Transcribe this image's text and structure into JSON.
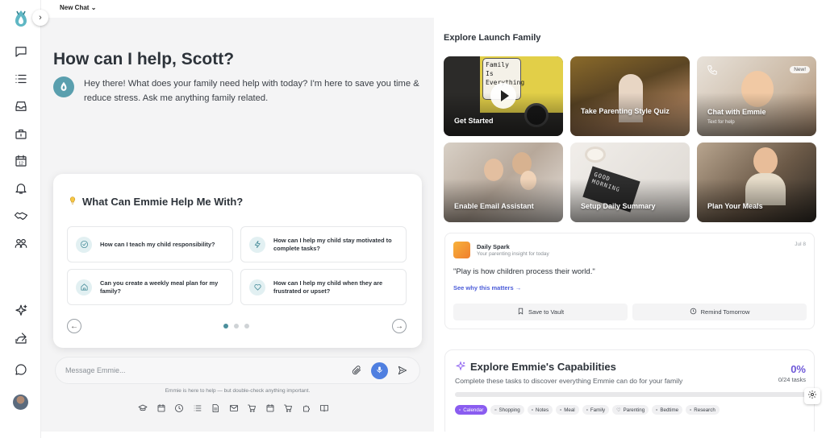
{
  "topbar": {
    "new_chat_label": "New Chat",
    "chevron": "chevron-down-icon"
  },
  "sidebar": {
    "items": [
      {
        "icon": "chat-bubble-icon"
      },
      {
        "icon": "list-icon"
      },
      {
        "icon": "inbox-icon"
      },
      {
        "icon": "briefcase-icon"
      },
      {
        "icon": "calendar-icon",
        "text": "12"
      },
      {
        "icon": "bell-icon"
      },
      {
        "icon": "handshake-icon"
      },
      {
        "icon": "people-icon"
      },
      {
        "icon": "sparkle-icon"
      },
      {
        "icon": "share-icon"
      },
      {
        "icon": "message-circle-icon"
      }
    ]
  },
  "main": {
    "greeting": "How can I help, Scott?",
    "intro": "Hey there! What does your family need help with today? I'm here to save you time & reduce stress. Ask me anything family related.",
    "help_card": {
      "title": "What Can Emmie Help Me With?",
      "questions": [
        {
          "text": "How can I teach my child responsibility?",
          "icon": "check-circle-icon"
        },
        {
          "text": "How can I help my child stay motivated to complete tasks?",
          "icon": "lightning-icon"
        },
        {
          "text": "Can you create a weekly meal plan for my family?",
          "icon": "home-icon"
        },
        {
          "text": "How can I help my child when they are frustrated or upset?",
          "icon": "heart-icon"
        }
      ],
      "active_page": 1,
      "pages": 3
    },
    "composer": {
      "placeholder": "Message Emmie..."
    },
    "disclaimer": "Emmie is here to help — but double-check anything important."
  },
  "explore": {
    "title": "Explore Launch Family",
    "tiles": [
      {
        "label": "Get Started",
        "note_text": "Family Is Everything"
      },
      {
        "label": "Take Parenting Style Quiz"
      },
      {
        "label": "Chat with Emmie",
        "sub": "Text for help",
        "badge": "New!"
      },
      {
        "label": "Enable Email Assistant"
      },
      {
        "label": "Setup Daily Summary",
        "board_text": "GOOD MORNING"
      },
      {
        "label": "Plan Your Meals"
      }
    ]
  },
  "daily_spark": {
    "title": "Daily Spark",
    "subtitle": "Your parenting insight for today",
    "date": "Jul 8",
    "quote": "\"Play is how children process their world.\"",
    "link": "See why this matters →",
    "save_label": "Save to Vault",
    "remind_label": "Remind Tomorrow"
  },
  "capabilities": {
    "title": "Explore Emmie's Capabilities",
    "subtitle": "Complete these tasks to discover everything Emmie can do for your family",
    "percent": "0%",
    "tasks": "0/24 tasks",
    "progress": 0,
    "chips": [
      "Calendar",
      "Shopping",
      "Notes",
      "Meal",
      "Family",
      "Parenting",
      "Bedtime",
      "Research"
    ]
  },
  "colors": {
    "accent": "#5a9fae",
    "purple": "#8a5cf0",
    "link": "#4a5bd8",
    "mic": "#4f7fe0"
  }
}
